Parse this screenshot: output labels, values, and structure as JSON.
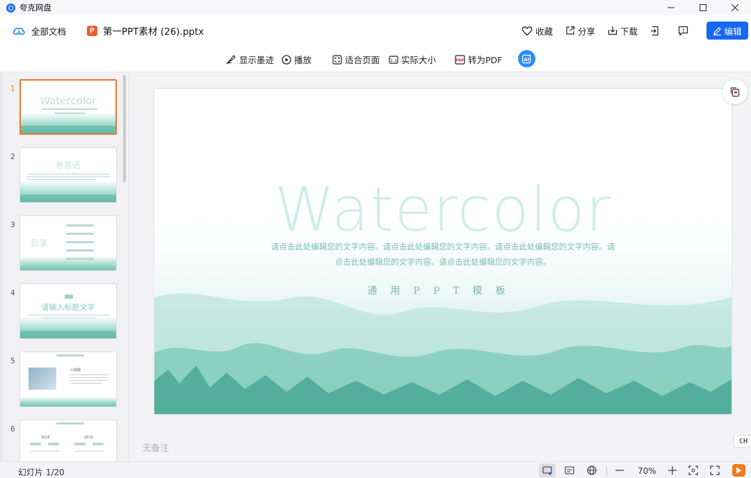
{
  "window": {
    "app_title": "夸克网盘",
    "controls": [
      "minimize",
      "maximize",
      "close"
    ]
  },
  "header": {
    "crumb_all": "全部文档",
    "file_name": "第一PPT素材 (26).pptx",
    "file_icon_letter": "P",
    "actions": {
      "favorite": "收藏",
      "share": "分享",
      "download": "下载",
      "edit": "编辑"
    }
  },
  "toolbar": {
    "ink": "显示墨迹",
    "play": "播放",
    "fit_page": "适合页面",
    "actual_size": "实际大小",
    "to_pdf": "转为PDF",
    "ai_label": "AI"
  },
  "thumbnails": [
    {
      "num": "1",
      "title": "Watercolor"
    },
    {
      "num": "2",
      "title": "卷首语"
    },
    {
      "num": "3",
      "title": "目录"
    },
    {
      "num": "4",
      "title": "请输入标题文字"
    },
    {
      "num": "5",
      "title": "小标题"
    },
    {
      "num": "6",
      "title": "2015"
    }
  ],
  "slide": {
    "title": "Watercolor",
    "body_line1": "请点击此处编辑您的文字内容。请点击此处编辑您的文字内容。请点击此处编辑您的文字内容。请",
    "body_line2": "点击此处编辑您的文字内容。请点击此处编辑您的文字内容。",
    "subtitle": "通用PPT模板"
  },
  "notes": "无备注",
  "statusbar": {
    "slide_count": "幻灯片 1/20",
    "zoom": "70%"
  },
  "overlay": {
    "ime_badge": "CH"
  },
  "colors": {
    "accent_blue": "#1768f0",
    "active_orange": "#e8782a",
    "watercolor_teal": "#5ab3a2",
    "title_mint": "#cdeee7"
  }
}
